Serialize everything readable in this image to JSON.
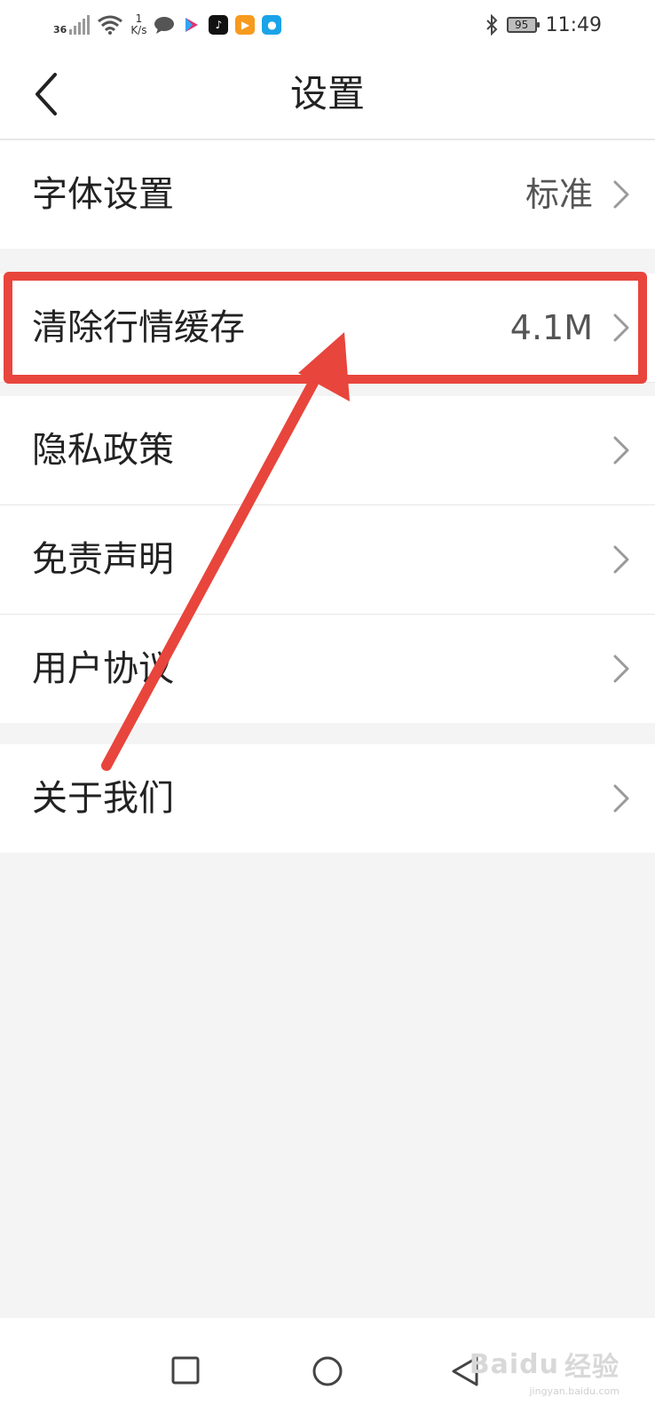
{
  "status_bar": {
    "network_type": "36",
    "net_speed_value": "1",
    "net_speed_unit": "K/s",
    "battery_level": "95",
    "time": "11:49",
    "icons": [
      "signal-icon",
      "wifi-icon",
      "message-icon",
      "youku-icon",
      "tiktok-icon",
      "video-icon",
      "bulb-icon",
      "bluetooth-icon",
      "battery-icon"
    ]
  },
  "nav": {
    "title": "设置",
    "back_icon": "chevron-left-icon"
  },
  "settings": {
    "font_label": "字体设置",
    "font_value": "标准",
    "cache_label": "清除行情缓存",
    "cache_value": "4.1M",
    "privacy_label": "隐私政策",
    "disclaimer_label": "免责声明",
    "agreement_label": "用户协议",
    "about_label": "关于我们"
  },
  "annotation": {
    "color": "#e8453c"
  },
  "system_nav": {
    "icons": [
      "recent-apps-icon",
      "home-icon",
      "back-icon"
    ]
  },
  "watermark": {
    "brand": "Baidu",
    "suffix": "经验",
    "url": "jingyan.baidu.com"
  },
  "colors": {
    "background": "#f4f4f4",
    "row_bg": "#ffffff",
    "text": "#222222",
    "value_text": "#555555",
    "chevron": "#9a9a9a"
  }
}
